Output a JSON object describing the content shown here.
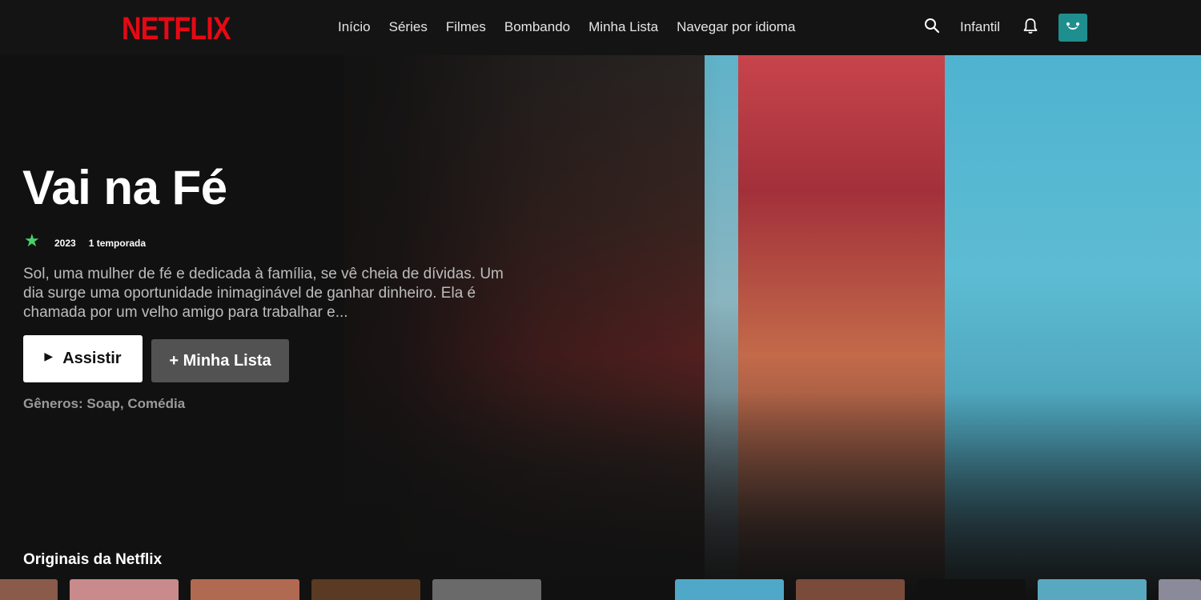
{
  "brand": {
    "logo_text": "NETFLIX",
    "color": "#e50914"
  },
  "nav": {
    "items": [
      "Início",
      "Séries",
      "Filmes",
      "Bombando",
      "Minha Lista",
      "Navegar por idioma"
    ]
  },
  "header_right": {
    "search_icon": "search-icon",
    "kids_label": "Infantil",
    "bell_icon": "bell-icon",
    "avatar_color": "#1f8e8f"
  },
  "hero": {
    "title": "Vai na Fé",
    "rating_icon": "star-icon",
    "year": "2023",
    "seasons": "1 temporada",
    "synopsis": "Sol, uma mulher de fé e dedicada à família, se vê cheia de dívidas. Um dia surge uma oportunidade inimaginável de ganhar dinheiro. Ela é chamada por um velho amigo para trabalhar e...",
    "play_label": "Assistir",
    "list_label": "+ Minha Lista",
    "genres": "Gêneros: Soap, Comédia"
  },
  "row": {
    "title": "Originais da Netflix",
    "tiles": [
      {
        "color": "#8a5a4a"
      },
      {
        "color": "#c88a8a"
      },
      {
        "color": "#b06a52"
      },
      {
        "color": "#5a3a22"
      },
      {
        "color": "#6a6a6a"
      },
      {
        "color": "#4fa8c8"
      },
      {
        "color": "#7a4a3a"
      },
      {
        "color": "#111111"
      },
      {
        "color": "#58a8c0"
      },
      {
        "color": "#8a8a9a"
      }
    ]
  }
}
